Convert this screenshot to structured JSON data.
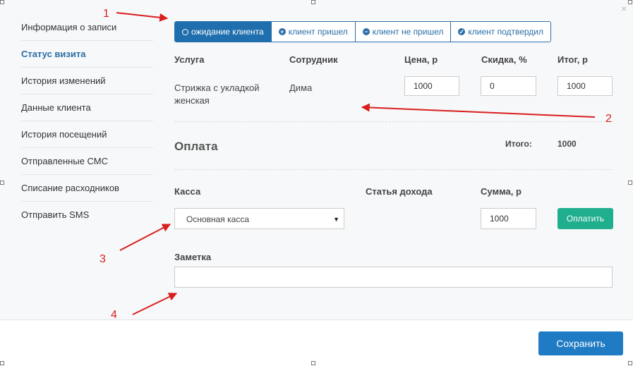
{
  "sidebar": {
    "items": [
      {
        "label": "Информация о записи"
      },
      {
        "label": "Статус визита"
      },
      {
        "label": "История изменений"
      },
      {
        "label": "Данные клиента"
      },
      {
        "label": "История посещений"
      },
      {
        "label": "Отправленные СМС"
      },
      {
        "label": "Списание расходников"
      },
      {
        "label": "Отправить SMS"
      }
    ],
    "active_index": 1
  },
  "status_tabs": [
    {
      "label": "ожидание клиента",
      "icon": "clock-icon",
      "active": true
    },
    {
      "label": "клиент пришел",
      "icon": "plus-circle-icon",
      "active": false
    },
    {
      "label": "клиент не пришел",
      "icon": "minus-circle-icon",
      "active": false
    },
    {
      "label": "клиент подтвердил",
      "icon": "check-circle-icon",
      "active": false
    }
  ],
  "services": {
    "headers": {
      "service": "Услуга",
      "employee": "Сотрудник",
      "price": "Цена, р",
      "discount": "Скидка, %",
      "total": "Итог, р"
    },
    "row": {
      "service": "Стрижка с укладкой женская",
      "employee": "Дима",
      "price": "1000",
      "discount": "0",
      "total": "1000"
    }
  },
  "payment": {
    "title": "Оплата",
    "total_label": "Итого:",
    "total_value": "1000",
    "cash_label": "Касса",
    "income_label": "Статья дохода",
    "amount_label": "Сумма, р",
    "cash_selected": "Основная касса",
    "amount_value": "1000",
    "pay_button": "Оплатить"
  },
  "note": {
    "label": "Заметка",
    "value": ""
  },
  "footer": {
    "save_button": "Сохранить"
  },
  "close_glyph": "×",
  "annotations": {
    "labels": [
      "1",
      "2",
      "3",
      "4"
    ],
    "color": "#d91e1e"
  }
}
